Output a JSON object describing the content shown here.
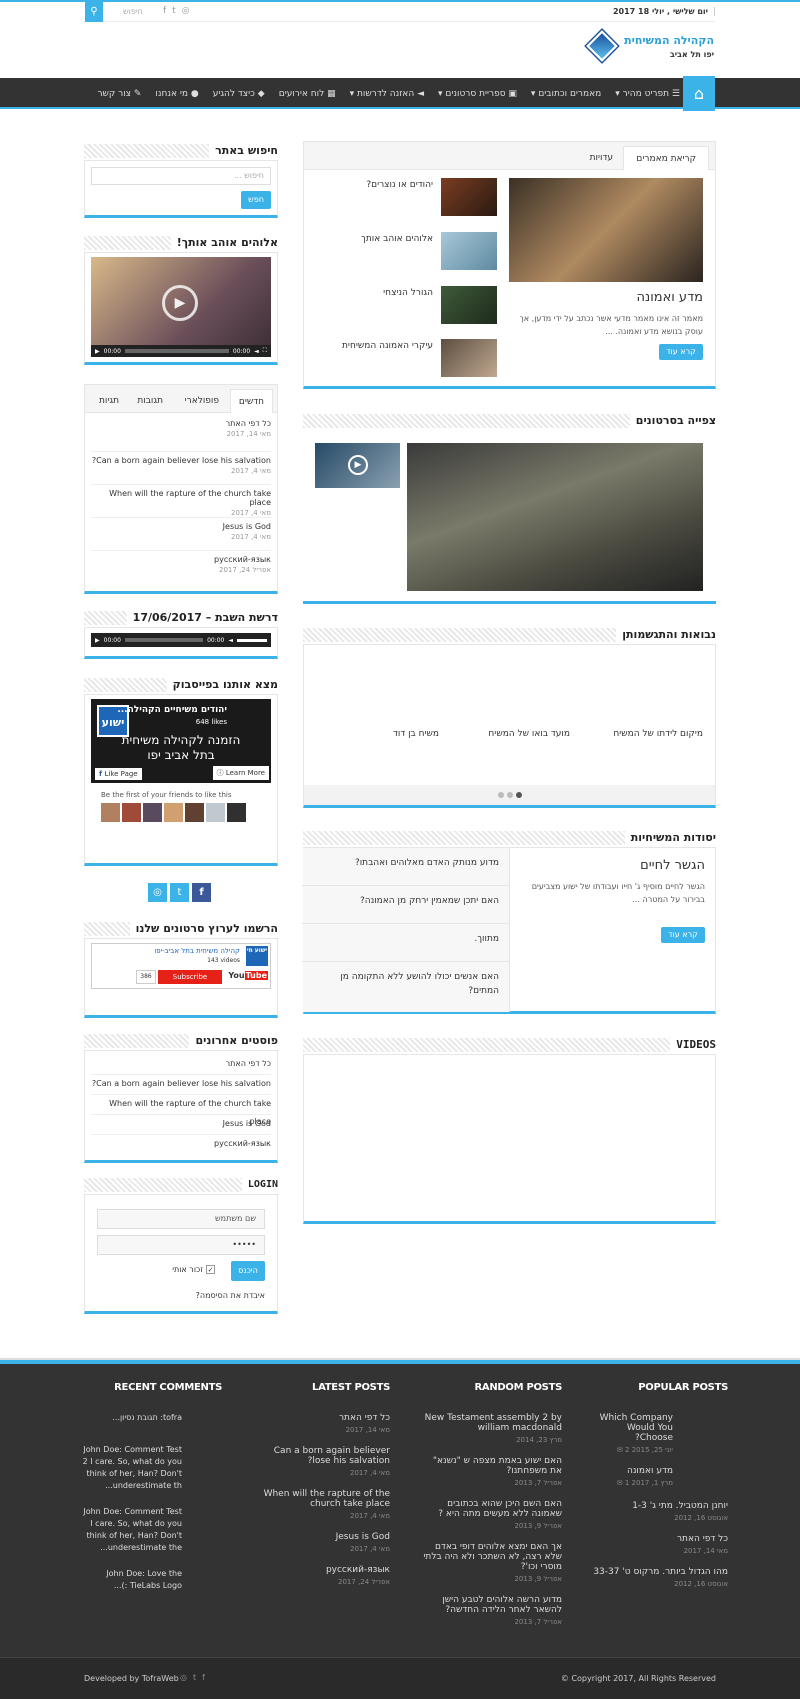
{
  "topbar": {
    "date": "יום שלישי , יולי 18 2017",
    "search_placeholder": "חיפוש"
  },
  "logo": {
    "title": "הקהילה המשיחית",
    "subtitle": "יפו תל אביב"
  },
  "nav": {
    "items": [
      "תפריט מהיר",
      "מאמרים וכתובים",
      "ספריית סרטונים",
      "האזנה לדרשות",
      "לוח אירועים",
      "כיצד להגיע",
      "מי אנחנו",
      "צור קשר"
    ]
  },
  "articles": {
    "tabs": [
      "קריאת מאמרים",
      "עדויות"
    ],
    "main_title": "מדע ואמונה",
    "main_excerpt": "מאמר זה אינו מאמר מדעי אשר נכתב על ידי מדען, אך עוסק בנושא מדע ואמונה. ...",
    "read_more": "קרא עוד",
    "side": [
      "יהודים או נוצרים?",
      "אלוהים אוהב אותך",
      "הגורל הניצחי",
      "עיקרי האמונה המשיחית"
    ]
  },
  "videos_section": {
    "title": "צפייה בסרטונים"
  },
  "prophecy": {
    "title": "נבואות והתגשמותן",
    "items": [
      "מיקום לידתו של המשיח",
      "מועד בואו של המשיח",
      "משיח בן דוד"
    ]
  },
  "foundations": {
    "title": "יסודות המשיחיות",
    "main_title": "הגשר לחיים",
    "main_excerpt": "הגשר לחיים מוסיף ג' חייו ועבודתו של ישוע מצביעים בבירור על המטרה ...",
    "read_more": "קרא עוד",
    "questions": [
      "מדוע מנותק האדם מאלוהים ואהבתו?",
      "האם יתכן שמאמין ירחק מן האמונה?",
      "מתווך.",
      "האם אנשים יכולו להושע ללא התקומה מן המתים?"
    ]
  },
  "videos_block": {
    "title": "VIDEOS"
  },
  "sidebar": {
    "search": {
      "title": "חיפוש באתר",
      "placeholder": "חיפוש ...",
      "button": "חפש"
    },
    "video": {
      "title": "אלוהים אוהב אותך!",
      "time_start": "00:00",
      "time_end": "00:00"
    },
    "tabs": {
      "labels": [
        "חדשים",
        "פופולארי",
        "תגובות",
        "תגיות"
      ],
      "posts": [
        {
          "title": "כל דפי האתר",
          "date": "מאי 14, 2017"
        },
        {
          "title": "Can a born again believer lose his salvation?",
          "date": "מאי 4, 2017"
        },
        {
          "title": "When will the rapture of the church take place",
          "date": "מאי 4, 2017"
        },
        {
          "title": "Jesus is God",
          "date": "מאי 4, 2017"
        },
        {
          "title": "русский-язык",
          "date": "אפריל 24, 2017"
        }
      ]
    },
    "sermon": {
      "title": "דרשת השבת – 17/06/2017",
      "time_start": "00:00",
      "time_end": "00:00"
    },
    "facebook": {
      "title": "מצא אותנו בפייסבוק",
      "page_name": "יהודים משיחיים הקהילה...",
      "likes": "648 likes",
      "invite": "הזמנה לקהילה משיחית בתל אביב יפו",
      "like_page": "Like Page",
      "learn_more": "Learn More",
      "friends": "Be the first of your friends to like this",
      "logo_text": "ישוע"
    },
    "youtube": {
      "title": "הרשמו לערוץ סרטונים שלנו",
      "channel": "קהילה משיחית בתל אביב-יפו",
      "videos": "143 videos",
      "subscribe": "Subscribe",
      "count": "386",
      "logo_text": "ישוע חי"
    },
    "recent": {
      "title": "פוסטים אחרונים",
      "items": [
        "כל דפי האתר",
        "Can a born again believer lose his salvation?",
        "When will the rapture of the church take place",
        "Jesus is God",
        "русский-язык"
      ]
    },
    "login": {
      "title": "LOGIN",
      "username": "שם משתמש",
      "password": "•••••",
      "remember": "זכור אותי",
      "submit": "היכנס",
      "forgot": "איבדת את הסיסמה?"
    }
  },
  "footer": {
    "popular": {
      "title": "POPULAR POSTS",
      "items": [
        {
          "t": "Which Company Would You Choose?",
          "d": "יוני 25, 2015",
          "c": "2"
        },
        {
          "t": "מדע ואמונה",
          "d": "מרץ 1, 2017",
          "c": "1"
        },
        {
          "t": "יוחנן המטביל. מתי ג' 1-3",
          "d": "אוגוסט 16, 2012"
        },
        {
          "t": "כל דפי האתר",
          "d": "מאי 14, 2017"
        },
        {
          "t": "מהו הגדול ביותר. מרקוס ט' 33-37",
          "d": "אוגוסט 16, 2012"
        }
      ]
    },
    "random": {
      "title": "RANDOM POSTS",
      "items": [
        {
          "t": "New Testament assembly 2 by william macdonald",
          "d": "מרץ 23, 2014"
        },
        {
          "t": "האם ישוע באמת מצפה ש \"נשנא\" את משפחתנו?",
          "d": "אפריל 7, 2013"
        },
        {
          "t": "האם השם היכן שהוא בכתובים שאמונה ללא מעשים מתה היא ?",
          "d": "אפריל 9, 2013"
        },
        {
          "t": "אך האם ימצא אלוהים דופי באדם שלא רצה, לא השתכר ולא היה בלתי מוסרי וכו'?",
          "d": "אפריל 9, 2013"
        },
        {
          "t": "מדוע הרשה אלוהים לטבע הישן להשאר לאחר הלידה החדשה?",
          "d": "אפריל 7, 2013"
        }
      ]
    },
    "latest": {
      "title": "LATEST POSTS",
      "items": [
        {
          "t": "כל דפי האתר",
          "d": "מאי 14, 2017"
        },
        {
          "t": "Can a born again believer lose his salvation?",
          "d": "מאי 4, 2017"
        },
        {
          "t": "When will the rapture of the church take place",
          "d": "מאי 4, 2017"
        },
        {
          "t": "Jesus is God",
          "d": "מאי 4, 2017"
        },
        {
          "t": "русский-язык",
          "d": "אפריל 24, 2017"
        }
      ]
    },
    "comments": {
      "title": "RECENT COMMENTS",
      "items": [
        "tofra: תגובת נסיון...",
        "John Doe: Comment Test 2 I care. So, what do you think of her, Han? Don't underestimate th...",
        "John Doe: Comment Test I care. So, what do you think of her, Han? Don't underestimate the...",
        "John Doe: Love the TieLabs Logo :)..."
      ]
    },
    "copyright": "© Copyright 2017, All Rights Reserved",
    "developed": "Developed by TofraWeb"
  }
}
